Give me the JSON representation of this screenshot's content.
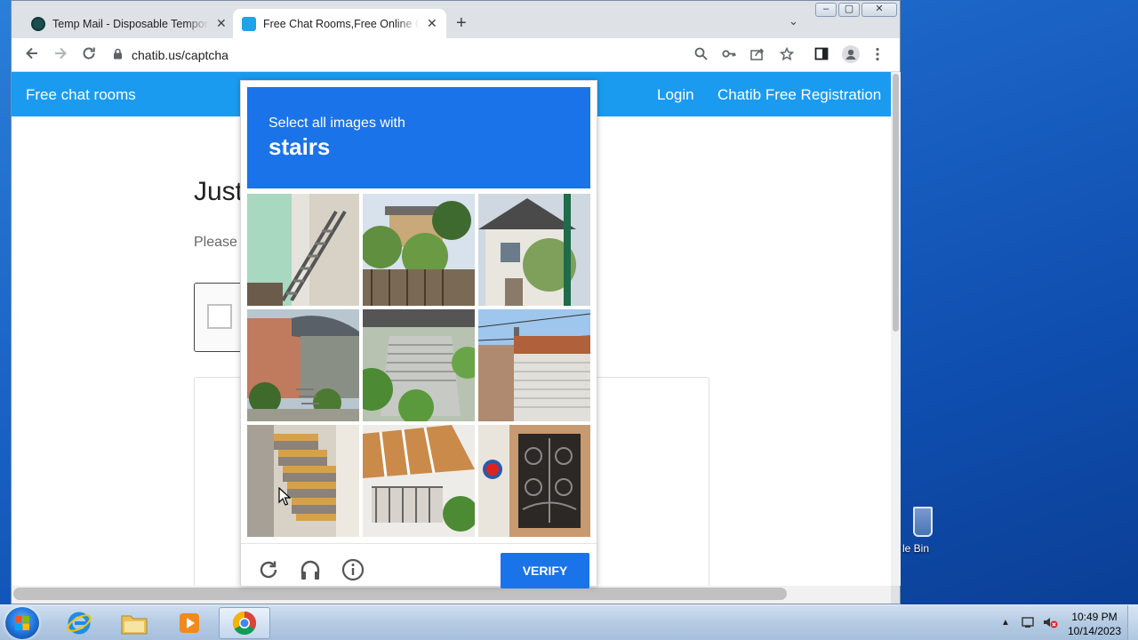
{
  "browser": {
    "tabs": [
      {
        "title": "Temp Mail - Disposable Temporary Email",
        "active": false
      },
      {
        "title": "Free Chat Rooms,Free Online Chat",
        "active": true
      }
    ],
    "url": "chatib.us/captcha"
  },
  "site": {
    "brand": "Free chat rooms",
    "login": "Login",
    "register": "Chatib Free Registration",
    "heading_visible": "Just",
    "subtext_visible": "Please"
  },
  "captcha": {
    "instruction": "Select all images with",
    "target": "stairs",
    "verify_label": "VERIFY",
    "tiles": [
      {
        "name": "tile-1"
      },
      {
        "name": "tile-2"
      },
      {
        "name": "tile-3"
      },
      {
        "name": "tile-4"
      },
      {
        "name": "tile-5"
      },
      {
        "name": "tile-6"
      },
      {
        "name": "tile-7"
      },
      {
        "name": "tile-8"
      },
      {
        "name": "tile-9"
      }
    ],
    "accent_color": "#1a73e8"
  },
  "desktop": {
    "recycle_bin_label": "le Bin"
  },
  "taskbar": {
    "time": "10:49 PM",
    "date": "10/14/2023"
  }
}
